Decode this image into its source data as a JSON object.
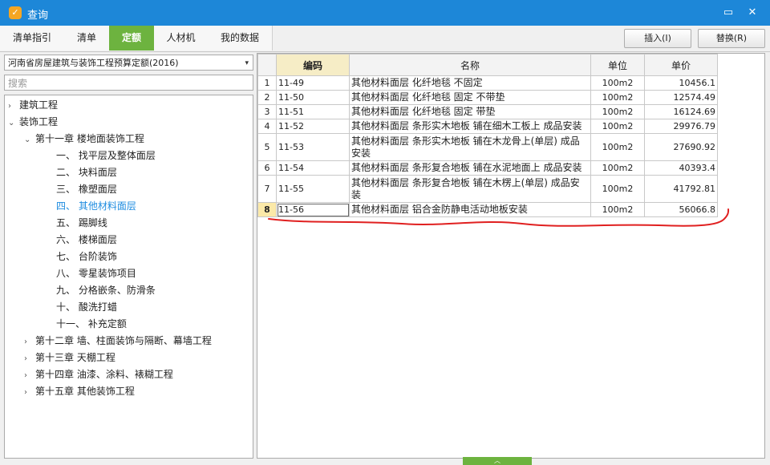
{
  "window": {
    "title": "查询",
    "app_icon": "app-logo-icon",
    "minimize": "▭",
    "close": "✕"
  },
  "tabs": [
    {
      "label": "清单指引",
      "active": false
    },
    {
      "label": "清单",
      "active": false
    },
    {
      "label": "定额",
      "active": true
    },
    {
      "label": "人材机",
      "active": false
    },
    {
      "label": "我的数据",
      "active": false
    }
  ],
  "toolbar": {
    "insert_label": "插入(I)",
    "replace_label": "替换(R)"
  },
  "left": {
    "quota_library": "河南省房屋建筑与装饰工程预算定额(2016)",
    "search_placeholder": "搜索",
    "tree": [
      {
        "label": "建筑工程",
        "chev": "›"
      },
      {
        "label": "装饰工程",
        "chev": "⌄"
      },
      {
        "label": "第十一章 楼地面装饰工程",
        "chev": "⌄"
      },
      {
        "label": "一、 找平层及整体面层",
        "chev": ""
      },
      {
        "label": "二、 块料面层",
        "chev": ""
      },
      {
        "label": "三、 橡塑面层",
        "chev": ""
      },
      {
        "label": "四、 其他材料面层",
        "chev": ""
      },
      {
        "label": "五、 踢脚线",
        "chev": ""
      },
      {
        "label": "六、 楼梯面层",
        "chev": ""
      },
      {
        "label": "七、 台阶装饰",
        "chev": ""
      },
      {
        "label": "八、 零星装饰项目",
        "chev": ""
      },
      {
        "label": "九、 分格嵌条、防滑条",
        "chev": ""
      },
      {
        "label": "十、 酸洗打蜡",
        "chev": ""
      },
      {
        "label": "十一、 补充定额",
        "chev": ""
      },
      {
        "label": "第十二章 墙、柱面装饰与隔断、幕墙工程",
        "chev": "›"
      },
      {
        "label": "第十三章 天棚工程",
        "chev": "›"
      },
      {
        "label": "第十四章 油漆、涂料、裱糊工程",
        "chev": "›"
      },
      {
        "label": "第十五章 其他装饰工程",
        "chev": "›"
      }
    ],
    "selected_index": 6
  },
  "grid": {
    "headers": {
      "code": "编码",
      "name": "名称",
      "unit": "单位",
      "price": "单价"
    },
    "rows": [
      {
        "n": "1",
        "code": "11-49",
        "name": "其他材料面层 化纤地毯 不固定",
        "unit": "100m2",
        "price": "10456.1"
      },
      {
        "n": "2",
        "code": "11-50",
        "name": "其他材料面层 化纤地毯 固定 不带垫",
        "unit": "100m2",
        "price": "12574.49"
      },
      {
        "n": "3",
        "code": "11-51",
        "name": "其他材料面层 化纤地毯 固定 带垫",
        "unit": "100m2",
        "price": "16124.69"
      },
      {
        "n": "4",
        "code": "11-52",
        "name": "其他材料面层 条形实木地板 铺在细木工板上 成品安装",
        "unit": "100m2",
        "price": "29976.79"
      },
      {
        "n": "5",
        "code": "11-53",
        "name": "其他材料面层 条形实木地板 铺在木龙骨上(单层) 成品安装",
        "unit": "100m2",
        "price": "27690.92"
      },
      {
        "n": "6",
        "code": "11-54",
        "name": "其他材料面层 条形复合地板 铺在水泥地面上 成品安装",
        "unit": "100m2",
        "price": "40393.4"
      },
      {
        "n": "7",
        "code": "11-55",
        "name": "其他材料面层 条形复合地板 铺在木楞上(单层) 成品安装",
        "unit": "100m2",
        "price": "41792.81"
      },
      {
        "n": "8",
        "code": "11-56",
        "name": "其他材料面层 铝合金防静电活动地板安装",
        "unit": "100m2",
        "price": "56066.8"
      }
    ],
    "selected_row": 8
  },
  "colors": {
    "titlebar": "#1d87d8",
    "active_tab": "#6db33f",
    "selected_tree": "#1e8ce0",
    "annotation": "#e02020"
  }
}
